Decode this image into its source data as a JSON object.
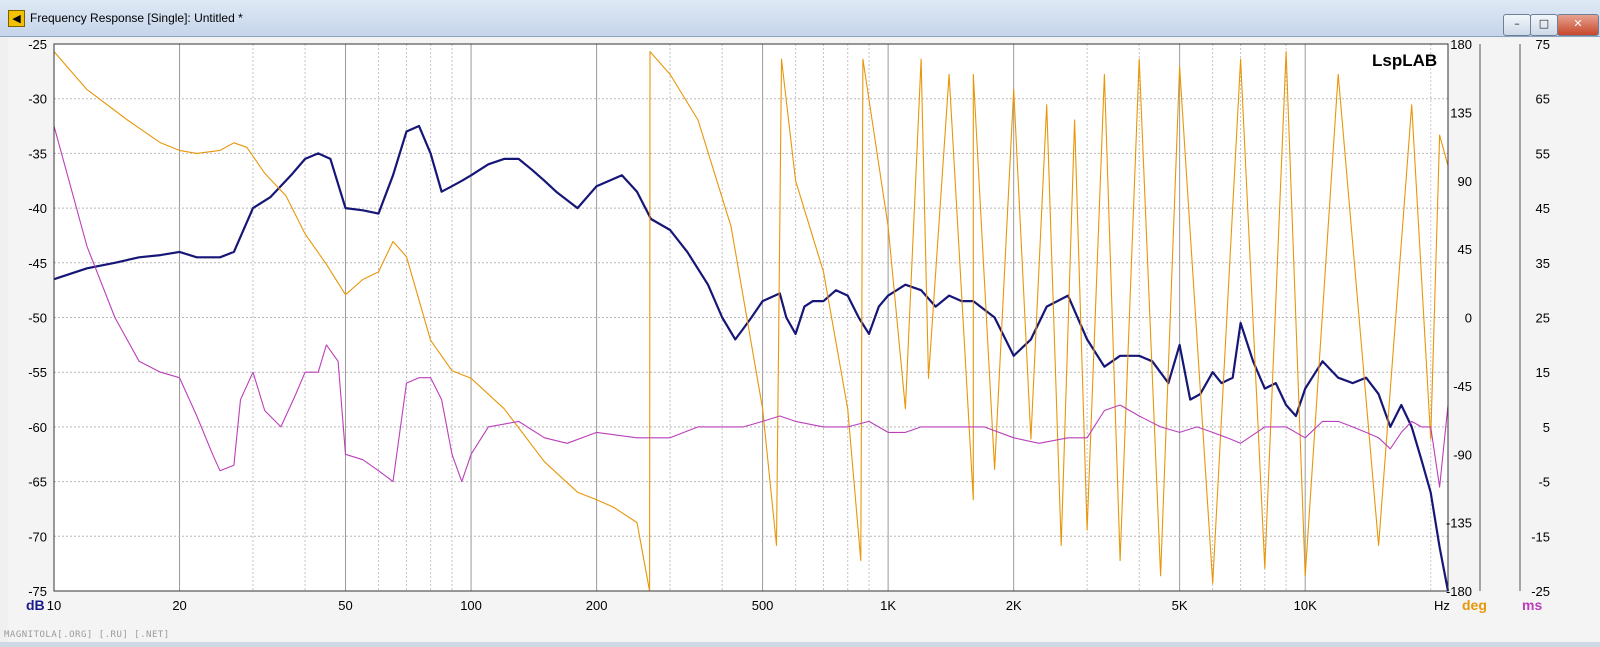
{
  "window": {
    "title": "Frequency Response [Single]: Untitled *",
    "icon": "speaker-icon",
    "controls": {
      "minimize": "–",
      "maximize": "□",
      "close": "✕"
    }
  },
  "watermark": "MAGNITOLA[.ORG] [.RU] [.NET]",
  "chart_data": {
    "type": "line",
    "title": "",
    "brand_label": "LspLAB",
    "x_scale": "log",
    "xlim": [
      10,
      22000
    ],
    "x_ticks": [
      10,
      20,
      50,
      100,
      200,
      500,
      1000,
      2000,
      5000,
      10000
    ],
    "x_tick_labels": [
      "10",
      "20",
      "50",
      "100",
      "200",
      "500",
      "1K",
      "2K",
      "5K",
      "10K"
    ],
    "x_unit_label": "Hz",
    "grid": true,
    "axes": {
      "left": {
        "unit": "dB",
        "color": "#1a1a8c",
        "ylim": [
          -75,
          -25
        ],
        "ticks": [
          -25,
          -30,
          -35,
          -40,
          -45,
          -50,
          -55,
          -60,
          -65,
          -70,
          -75
        ]
      },
      "right_phase": {
        "unit": "deg",
        "color": "#e8960a",
        "ylim": [
          -180,
          180
        ],
        "ticks": [
          180,
          135,
          90,
          45,
          0,
          -45,
          -90,
          -135,
          -180
        ]
      },
      "right_delay": {
        "unit": "ms",
        "color": "#bb3fbb",
        "ylim": [
          -25,
          75
        ],
        "ticks": [
          75,
          65,
          55,
          45,
          35,
          25,
          15,
          5,
          -5,
          -15,
          -25
        ]
      }
    },
    "series": [
      {
        "axis": "left",
        "color": "#161677",
        "x": [
          10,
          12,
          14,
          16,
          18,
          20,
          22,
          25,
          27,
          30,
          33,
          37,
          40,
          43,
          46,
          50,
          55,
          60,
          65,
          70,
          75,
          80,
          85,
          90,
          95,
          100,
          110,
          120,
          130,
          140,
          150,
          160,
          180,
          200,
          230,
          250,
          270,
          300,
          330,
          370,
          400,
          430,
          450,
          470,
          500,
          550,
          570,
          600,
          630,
          660,
          700,
          750,
          800,
          850,
          900,
          950,
          1000,
          1100,
          1200,
          1300,
          1400,
          1500,
          1600,
          1800,
          2000,
          2200,
          2400,
          2700,
          3000,
          3300,
          3600,
          4000,
          4300,
          4700,
          5000,
          5300,
          5600,
          6000,
          6300,
          6700,
          7000,
          7500,
          8000,
          8500,
          9000,
          9500,
          10000,
          11000,
          12000,
          13000,
          14000,
          15000,
          16000,
          17000,
          18000,
          19000,
          20000,
          21000,
          22000
        ],
        "y": [
          -46.5,
          -45.5,
          -45,
          -44.5,
          -44.3,
          -44,
          -44.5,
          -44.5,
          -44,
          -40,
          -39,
          -37,
          -35.5,
          -35,
          -35.5,
          -40,
          -40.2,
          -40.5,
          -37,
          -33,
          -32.5,
          -35,
          -38.5,
          -38,
          -37.5,
          -37,
          -36,
          -35.5,
          -35.5,
          -36.5,
          -37.5,
          -38.5,
          -40,
          -38,
          -37,
          -38.5,
          -41,
          -42,
          -44,
          -47,
          -50,
          -52,
          -51,
          -50,
          -48.5,
          -47.8,
          -50,
          -51.5,
          -49,
          -48.5,
          -48.5,
          -47.5,
          -48,
          -50,
          -51.5,
          -49,
          -48,
          -47,
          -47.5,
          -49,
          -48,
          -48.5,
          -48.5,
          -50,
          -53.5,
          -52,
          -49,
          -48,
          -52,
          -54.5,
          -53.5,
          -53.5,
          -54,
          -56,
          -52.5,
          -57.5,
          -57,
          -55,
          -56,
          -55.5,
          -50.5,
          -54,
          -56.5,
          -56,
          -58,
          -59,
          -56.5,
          -54,
          -55.5,
          -56,
          -55.5,
          -57,
          -60,
          -58,
          -60,
          -63,
          -66,
          -71,
          -75
        ]
      },
      {
        "axis": "right_phase",
        "color": "#e8960a",
        "x": [
          10,
          12,
          15,
          18,
          20,
          22,
          25,
          27,
          29,
          32,
          36,
          40,
          45,
          50,
          55,
          60,
          65,
          70,
          80,
          90,
          100,
          120,
          150,
          180,
          200,
          220,
          250,
          268,
          268.5,
          300,
          350,
          420,
          500,
          540,
          555,
          600,
          700,
          800,
          860,
          870,
          1000,
          1100,
          1200,
          1250,
          1400,
          1600,
          1600.5,
          1800,
          2000,
          2200,
          2400,
          2600,
          2800,
          3000,
          3300,
          3600,
          4000,
          4500,
          5000,
          6000,
          7000,
          8000,
          9000,
          10000,
          12000,
          15000,
          18000,
          20000,
          21000,
          22000
        ],
        "y": [
          175,
          150,
          130,
          115,
          110,
          108,
          110,
          115,
          112,
          95,
          80,
          55,
          35,
          15,
          25,
          30,
          50,
          40,
          -15,
          -35,
          -40,
          -60,
          -95,
          -115,
          -120,
          -125,
          -135,
          -180,
          175,
          160,
          130,
          60,
          -60,
          -150,
          170,
          90,
          30,
          -60,
          -160,
          170,
          60,
          -60,
          170,
          -40,
          160,
          -120,
          160,
          -100,
          150,
          -80,
          140,
          -150,
          130,
          -140,
          160,
          -160,
          170,
          -170,
          165,
          -175,
          170,
          -165,
          175,
          -170,
          160,
          -150,
          140,
          -80,
          120,
          100
        ]
      },
      {
        "axis": "right_delay",
        "color": "#bb3fbb",
        "x": [
          10,
          12,
          14,
          16,
          18,
          20,
          22,
          24,
          25,
          27,
          28,
          30,
          32,
          35,
          38,
          40,
          43,
          45,
          48,
          50,
          55,
          60,
          65,
          70,
          75,
          80,
          85,
          90,
          95,
          100,
          110,
          130,
          150,
          170,
          200,
          250,
          300,
          350,
          400,
          450,
          500,
          550,
          600,
          700,
          800,
          900,
          1000,
          1100,
          1200,
          1500,
          1700,
          2000,
          2300,
          2700,
          3000,
          3300,
          3600,
          4000,
          4500,
          5000,
          5500,
          6000,
          6500,
          7000,
          8000,
          9000,
          10000,
          11000,
          12000,
          13000,
          14000,
          15000,
          16000,
          17000,
          18000,
          19000,
          20000,
          21000,
          22000
        ],
        "y": [
          60,
          38,
          25,
          17,
          15,
          14,
          7,
          0,
          -3,
          -2,
          10,
          15,
          8,
          5,
          11,
          15,
          15,
          20,
          17,
          0,
          -1,
          -3,
          -5,
          13,
          14,
          14,
          10,
          0,
          -5,
          0,
          5,
          6,
          3,
          2,
          4,
          3,
          3,
          5,
          5,
          5,
          6,
          7,
          6,
          5,
          5,
          6,
          4,
          4,
          5,
          5,
          5,
          3,
          2,
          3,
          3,
          8,
          9,
          7,
          5,
          4,
          5,
          4,
          3,
          2,
          5,
          5,
          3,
          6,
          6,
          5,
          4,
          3,
          1,
          4,
          6,
          5,
          5,
          -6,
          9
        ]
      }
    ]
  }
}
